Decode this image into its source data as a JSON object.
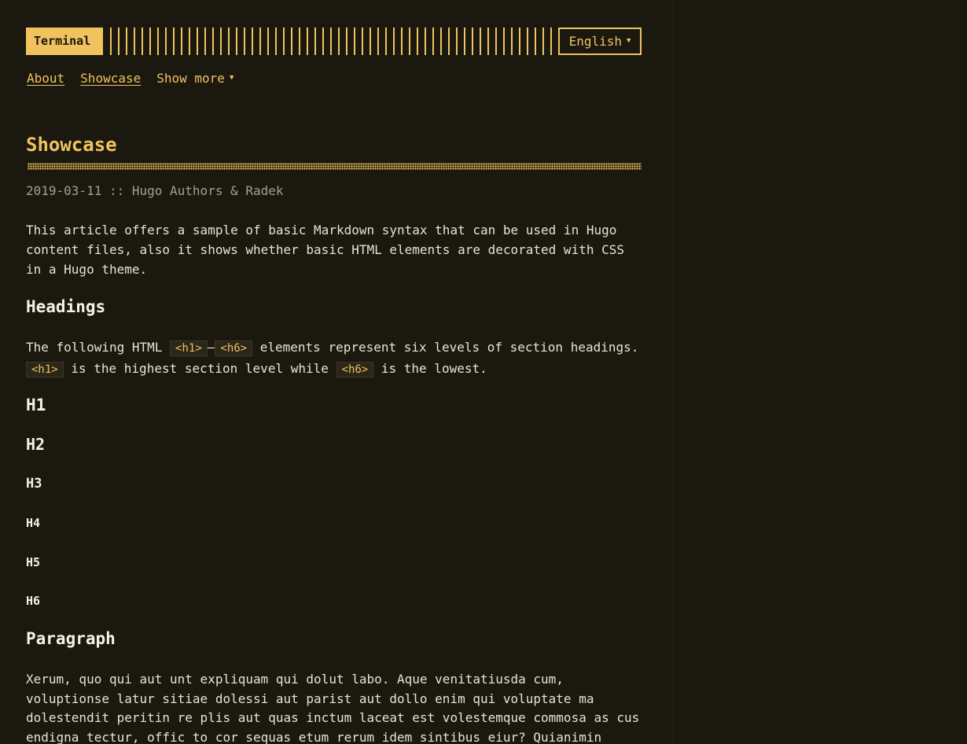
{
  "header": {
    "logo_text": "Terminal",
    "language": "English"
  },
  "nav": {
    "items": [
      {
        "label": "About"
      },
      {
        "label": "Showcase"
      }
    ],
    "more_label": "Show more"
  },
  "post": {
    "title": "Showcase",
    "meta": "2019-03-11 :: Hugo Authors & Radek",
    "intro": "This article offers a sample of basic Markdown syntax that can be used in Hugo content files, also it shows whether basic HTML elements are decorated with CSS in a Hugo theme.",
    "headings_title": "Headings",
    "headings_text": {
      "part1": "The following HTML",
      "code1": "<h1>",
      "dash": "—",
      "code2": "<h6>",
      "part2": "elements represent six levels of section headings.",
      "code3": "<h1>",
      "part3": "is the highest section level while",
      "code4": "<h6>",
      "part4": "is the lowest."
    },
    "h1": "H1",
    "h2": "H2",
    "h3": "H3",
    "h4": "H4",
    "h5": "H5",
    "h6": "H6",
    "paragraph_title": "Paragraph",
    "paragraph_text": "Xerum, quo qui aut unt expliquam qui dolut labo. Aque venitatiusda cum, voluptionse latur sitiae dolessi aut parist aut dollo enim qui voluptate ma dolestendit peritin re plis aut quas inctum laceat est volestemque commosa as cus endigna tectur, offic to cor sequas etum rerum idem sintibus eiur? Quianimin"
  }
}
